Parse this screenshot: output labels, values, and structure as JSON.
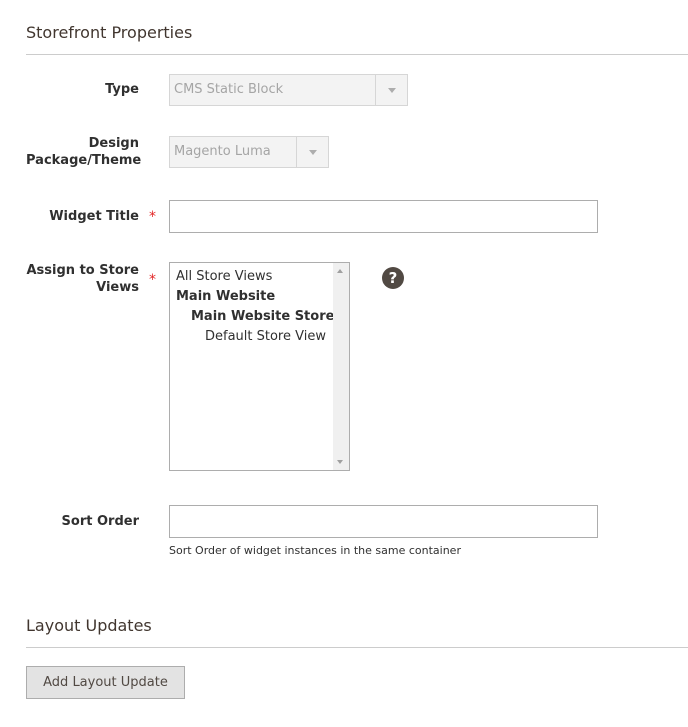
{
  "storefront": {
    "title": "Storefront Properties"
  },
  "fields": {
    "type": {
      "label": "Type",
      "value": "CMS Static Block"
    },
    "theme": {
      "label_line1": "Design",
      "label_line2": "Package/Theme",
      "value": "Magento Luma"
    },
    "widget_title": {
      "label": "Widget Title",
      "required_mark": "*",
      "value": ""
    },
    "store_views": {
      "label_line1": "Assign to Store",
      "label_line2": "Views",
      "required_mark": "*",
      "options": [
        "All Store Views",
        "Main Website",
        "Main Website Store",
        "Default Store View"
      ],
      "help_icon": "?"
    },
    "sort_order": {
      "label": "Sort Order",
      "value": "",
      "note": "Sort Order of widget instances in the same container"
    }
  },
  "layout_updates": {
    "title": "Layout Updates",
    "add_button_label": "Add Layout Update"
  },
  "colors": {
    "required": "#e22626",
    "help_icon_bg": "#514943",
    "button_bg": "#e3e3e3"
  }
}
